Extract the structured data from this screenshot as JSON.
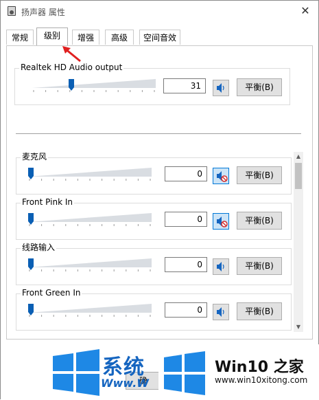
{
  "window": {
    "title": "扬声器 属性",
    "close_glyph": "✕"
  },
  "tabs": [
    {
      "label": "常规",
      "active": false
    },
    {
      "label": "级别",
      "active": true
    },
    {
      "label": "增强",
      "active": false
    },
    {
      "label": "高级",
      "active": false
    },
    {
      "label": "空间音效",
      "active": false
    }
  ],
  "output": {
    "label": "Realtek HD Audio output",
    "value": "31",
    "level": 0.31,
    "muted": false,
    "balance_label": "平衡(B)"
  },
  "inputs": [
    {
      "label": "麦克风",
      "value": "0",
      "level": 0,
      "muted": true,
      "balance_label": "平衡(B)"
    },
    {
      "label": "Front Pink In",
      "value": "0",
      "level": 0,
      "muted": true,
      "balance_label": "平衡(B)"
    },
    {
      "label": "线路输入",
      "value": "0",
      "level": 0,
      "muted": false,
      "balance_label": "平衡(B)"
    },
    {
      "label": "Front Green In",
      "value": "0",
      "level": 0,
      "muted": false,
      "balance_label": "平衡(B)"
    }
  ],
  "scrollbar": {
    "up_glyph": "▲",
    "down_glyph": "▼"
  },
  "watermark": {
    "left_text": "系统",
    "left_url": "Www.W",
    "right_brand": "Win10 之家",
    "right_url": "www.win10xitong.com",
    "partial_button": "确"
  },
  "colors": {
    "accent": "#0078d7",
    "thumb": "#0a5fb4",
    "watermark_blue": "#1565c0",
    "arrow": "#e02020"
  }
}
